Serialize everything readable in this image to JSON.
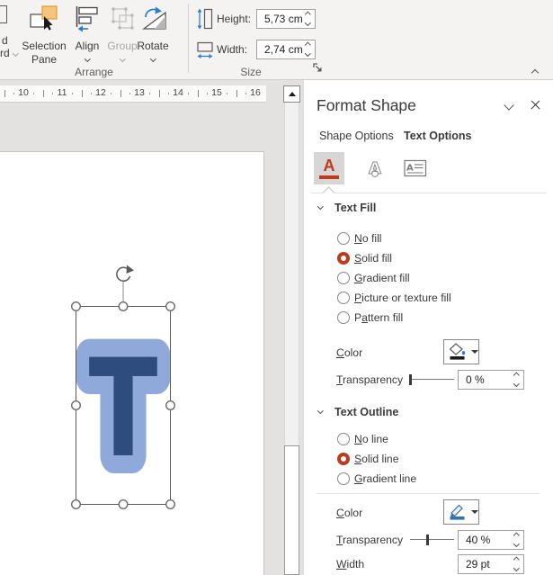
{
  "ribbon": {
    "clipped_button": {
      "line1_fragment": "d",
      "line2_fragment": "rd"
    },
    "selection_pane": {
      "line1": "Selection",
      "line2": "Pane"
    },
    "align_label": "Align",
    "group_label": "Group",
    "rotate_label": "Rotate",
    "arrange_group_label": "Arrange",
    "size_group_label": "Size",
    "height_label": "Height:",
    "height_value": "5,73 cm",
    "width_label": "Width:",
    "width_value": "2,74 cm"
  },
  "canvas": {
    "ruler_numbers": [
      "10",
      "11",
      "12",
      "13",
      "14",
      "15",
      "16"
    ],
    "letter": "T"
  },
  "panel": {
    "title": "Format Shape",
    "tabs": {
      "shape_options": {
        "label": "Shape Options",
        "selected": false
      },
      "text_options": {
        "label": "Text Options",
        "selected": true
      }
    },
    "icon_tabs": {
      "text_fill_outline": {
        "selected": true
      },
      "text_effects": {
        "selected": false
      },
      "textbox": {
        "selected": false
      }
    },
    "text_fill": {
      "heading": "Text Fill",
      "options": [
        {
          "pre": "",
          "u": "N",
          "post": "o fill",
          "selected": false
        },
        {
          "pre": "",
          "u": "S",
          "post": "olid fill",
          "selected": true
        },
        {
          "pre": "",
          "u": "G",
          "post": "radient fill",
          "selected": false
        },
        {
          "pre": "",
          "u": "P",
          "post": "icture or texture fill",
          "selected": false
        },
        {
          "pre": "P",
          "u": "a",
          "post": "ttern fill",
          "selected": false
        }
      ],
      "color_label": {
        "pre": "",
        "u": "C",
        "post": "olor"
      },
      "transparency_label": {
        "pre": "",
        "u": "T",
        "post": "ransparency"
      },
      "transparency_value": "0 %",
      "transparency_percent": 0
    },
    "text_outline": {
      "heading": "Text Outline",
      "options": [
        {
          "pre": "",
          "u": "N",
          "post": "o line",
          "selected": false
        },
        {
          "pre": "",
          "u": "S",
          "post": "olid line",
          "selected": true
        },
        {
          "pre": "",
          "u": "G",
          "post": "radient line",
          "selected": false
        }
      ],
      "color_label": {
        "pre": "",
        "u": "C",
        "post": "olor"
      },
      "transparency_label": {
        "pre": "",
        "u": "T",
        "post": "ransparency"
      },
      "transparency_value": "40 %",
      "transparency_percent": 40,
      "width_label": {
        "pre": "",
        "u": "W",
        "post": "idth"
      },
      "width_value": "29 pt"
    }
  },
  "colors": {
    "accent_red": "#c0391b",
    "letter_fill": "#2e4c7e",
    "letter_outline_rendered": "#8fa9db",
    "ribbon_icon_blue": "#2b7cd3",
    "selection_pane_orange": "#f6c57d"
  }
}
